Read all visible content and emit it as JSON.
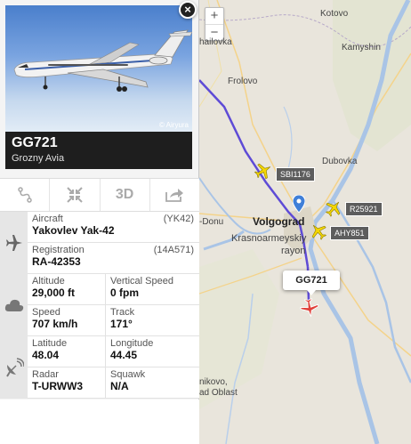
{
  "panel": {
    "close_symbol": "×",
    "photo_credit": "© Airyura",
    "callsign": "GG721",
    "airline": "Grozny Avia",
    "toolbar": [
      {
        "name": "route-icon",
        "label": ""
      },
      {
        "name": "fit-view-icon",
        "label": ""
      },
      {
        "name": "3d-view-button",
        "label": "3D"
      },
      {
        "name": "share-icon",
        "label": ""
      }
    ],
    "aircraft": {
      "label": "Aircraft",
      "code": "(YK42)",
      "value": "Yakovlev Yak-42"
    },
    "registration": {
      "label": "Registration",
      "code": "(14A571)",
      "value": "RA-42353"
    },
    "altitude": {
      "label": "Altitude",
      "value": "29,000 ft"
    },
    "vertical_speed": {
      "label": "Vertical Speed",
      "value": "0 fpm"
    },
    "speed": {
      "label": "Speed",
      "value": "707 km/h"
    },
    "track": {
      "label": "Track",
      "value": "171°"
    },
    "latitude": {
      "label": "Latitude",
      "value": "48.04"
    },
    "longitude": {
      "label": "Longitude",
      "value": "44.45"
    },
    "radar": {
      "label": "Radar",
      "value": "T-URWW3"
    },
    "squawk": {
      "label": "Squawk",
      "value": "N/A"
    }
  },
  "map": {
    "zoom_in": "+",
    "zoom_out": "−",
    "places": {
      "kotovo": "Kotovo",
      "khaylovka": "hailovka",
      "kamyshin": "Kamyshin",
      "frolovo": "Frolovo",
      "dubovka": "Dubovka",
      "volgograd": "Volgograd",
      "don": "-Donu",
      "krasnoarmeysky": "Krasnoarmeyskiy",
      "rayon": "rayon",
      "nikovo": "nikovo,",
      "oblast": "ad Oblast"
    },
    "flights": {
      "f1": "SBI1176",
      "f2": "R25921",
      "f3": "AHY851"
    },
    "selected_flight": "GG721",
    "colors": {
      "track": "#5e4bd6",
      "selected_plane": "#e0403a",
      "other_planes": "#f4d600"
    }
  }
}
